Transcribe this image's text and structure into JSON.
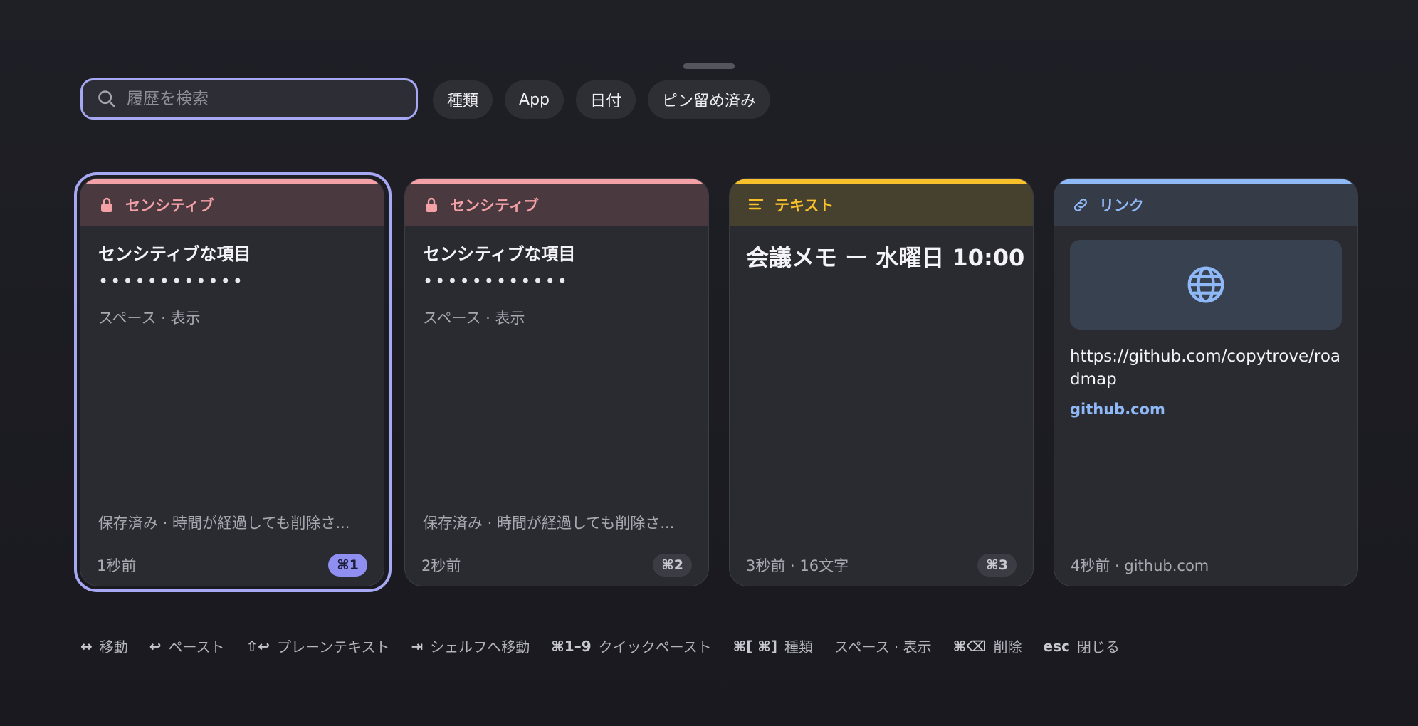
{
  "search": {
    "placeholder": "履歴を検索"
  },
  "filters": [
    {
      "label": "種類"
    },
    {
      "label": "App"
    },
    {
      "label": "日付"
    },
    {
      "label": "ピン留め済み"
    }
  ],
  "cards": [
    {
      "kind_label": "センシティブ",
      "title": "センシティブな項目",
      "masked": "••••••••••••",
      "hint": "スペース · 表示",
      "note": "保存済み · 時間が経過しても削除さ...",
      "meta": "1秒前",
      "shortcut": "⌘1",
      "accent": "#f3a0a6",
      "header_bg": "#4a3a40"
    },
    {
      "kind_label": "センシティブ",
      "title": "センシティブな項目",
      "masked": "••••••••••••",
      "hint": "スペース · 表示",
      "note": "保存済み · 時間が経過しても削除さ...",
      "meta": "2秒前",
      "shortcut": "⌘2",
      "accent": "#f3a0a6",
      "header_bg": "#4a3a40"
    },
    {
      "kind_label": "テキスト",
      "body": "会議メモ ー 水曜日 10:00",
      "meta": "3秒前 · 16文字",
      "shortcut": "⌘3",
      "accent": "#f8c02a",
      "header_bg": "#46402f"
    },
    {
      "kind_label": "リンク",
      "url": "https://github.com/copytrove/roadmap",
      "domain": "github.com",
      "meta": "4秒前 · github.com",
      "accent": "#8fb9f6",
      "header_bg": "#353b47"
    }
  ],
  "shortcuts": [
    {
      "key": "↔",
      "label": "移動"
    },
    {
      "key": "↩",
      "label": "ペースト"
    },
    {
      "key": "⇧↩",
      "label": "プレーンテキスト"
    },
    {
      "key": "⇥",
      "label": "シェルフへ移動"
    },
    {
      "key": "⌘1–9",
      "label": "クイックペースト"
    },
    {
      "key": "⌘[  ⌘]",
      "label": "種類"
    },
    {
      "key": "",
      "label": "スペース · 表示"
    },
    {
      "key": "⌘⌫",
      "label": "削除"
    },
    {
      "key": "esc",
      "label": "閉じる"
    }
  ]
}
